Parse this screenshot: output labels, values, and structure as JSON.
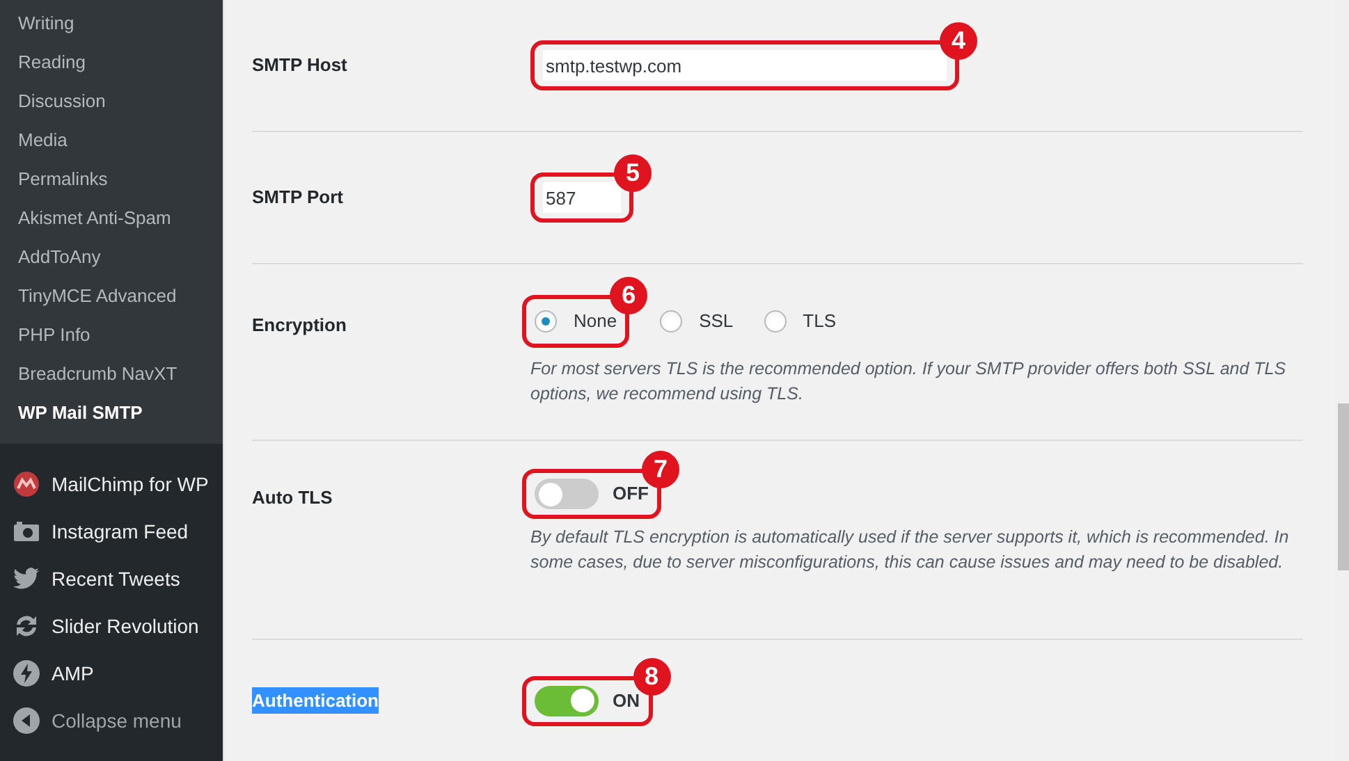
{
  "sidebar": {
    "submenu": [
      {
        "label": "Writing",
        "selected": false
      },
      {
        "label": "Reading",
        "selected": false
      },
      {
        "label": "Discussion",
        "selected": false
      },
      {
        "label": "Media",
        "selected": false
      },
      {
        "label": "Permalinks",
        "selected": false
      },
      {
        "label": "Akismet Anti-Spam",
        "selected": false
      },
      {
        "label": "AddToAny",
        "selected": false
      },
      {
        "label": "TinyMCE Advanced",
        "selected": false
      },
      {
        "label": "PHP Info",
        "selected": false
      },
      {
        "label": "Breadcrumb NavXT",
        "selected": false
      },
      {
        "label": "WP Mail SMTP",
        "selected": true
      }
    ],
    "menu": [
      {
        "label": "MailChimp for WP"
      },
      {
        "label": "Instagram Feed"
      },
      {
        "label": "Recent Tweets"
      },
      {
        "label": "Slider Revolution"
      },
      {
        "label": "AMP"
      },
      {
        "label": "Collapse menu"
      }
    ]
  },
  "settings": [
    {
      "kind": "text",
      "label": "SMTP Host",
      "value": "smtp.testwp.com",
      "callout": "4"
    },
    {
      "kind": "text",
      "label": "SMTP Port",
      "value": "587",
      "callout": "5"
    },
    {
      "kind": "radio",
      "label": "Encryption",
      "callout": "6",
      "options": [
        {
          "label": "None",
          "selected": true
        },
        {
          "label": "SSL",
          "selected": false
        },
        {
          "label": "TLS",
          "selected": false
        }
      ],
      "description": "For most servers TLS is the recommended option. If your SMTP provider offers both SSL and TLS options, we recommend using TLS."
    },
    {
      "kind": "toggle",
      "label": "Auto TLS",
      "on": false,
      "state_label": "OFF",
      "callout": "7",
      "description": "By default TLS encryption is automatically used if the server supports it, which is recommended. In some cases, due to server misconfigurations, this can cause issues and may need to be disabled."
    },
    {
      "kind": "toggle",
      "label": "Authentication",
      "label_highlighted": true,
      "on": true,
      "state_label": "ON",
      "callout": "8"
    }
  ]
}
